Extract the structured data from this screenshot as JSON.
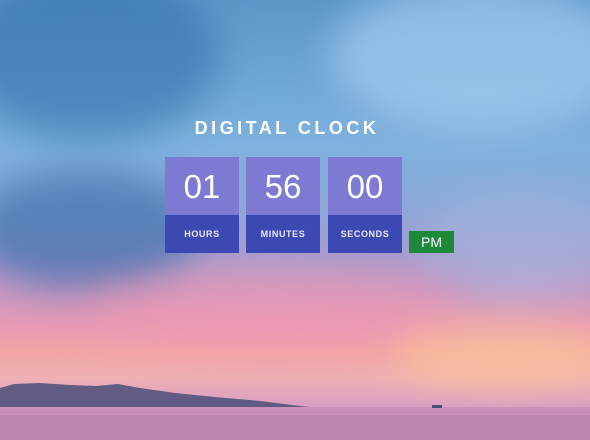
{
  "clock": {
    "title": "DIGITAL CLOCK",
    "hours": "01",
    "hours_label": "HOURS",
    "minutes": "56",
    "minutes_label": "MINUTES",
    "seconds": "00",
    "seconds_label": "SECONDS",
    "period": "PM"
  },
  "colors": {
    "digit_box": "#7e7ad3",
    "label_box": "#3d49b3",
    "period_badge": "#1d8a3a"
  }
}
